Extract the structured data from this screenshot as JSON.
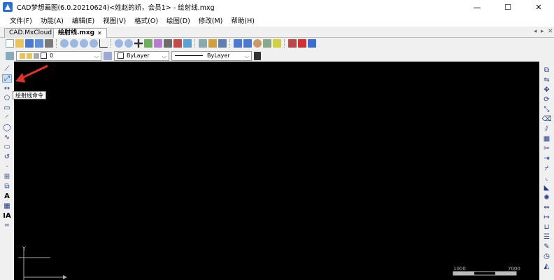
{
  "window": {
    "title": "CAD梦想画图(6.0.20210624)<姓赵的娇，会员1> - 绘射线.mxg",
    "minimize": "—",
    "maximize": "☐",
    "close": "✕"
  },
  "menu": [
    "文件(F)",
    "功能(A)",
    "编辑(E)",
    "视图(V)",
    "格式(O)",
    "绘图(D)",
    "修改(M)",
    "帮助(H)"
  ],
  "tabs": [
    {
      "label": "CAD.MxCloud",
      "active": false
    },
    {
      "label": "绘射线.mxg",
      "active": true
    }
  ],
  "tab_controls": {
    "left": "◂",
    "right": "▸",
    "close": "✕"
  },
  "layer_bar": {
    "layer_value": "0",
    "color_value": "ByLayer",
    "linetype_value": "ByLayer"
  },
  "tooltip": "绘射线命令",
  "canvas": {
    "ucs_y": "Y",
    "scale_labels": [
      "1000",
      "7000"
    ]
  },
  "colors": {
    "canvas_bg": "#000000",
    "annotation_arrow": "#e0302a",
    "icon_blue": "#1f3f8a"
  },
  "icons": {
    "left_toolbar": [
      "line-icon",
      "ray-icon",
      "xline-icon",
      "polygon-icon",
      "rectangle-icon",
      "arc-icon",
      "circle-icon",
      "spline-icon",
      "ellipse-icon",
      "ellipse-arc-icon",
      "point-icon",
      "insert-block-icon",
      "make-block-icon",
      "text-icon",
      "hatch-icon",
      "mtext-icon",
      "table-icon"
    ],
    "right_toolbar": [
      "copy-icon",
      "mirror-icon",
      "move-icon",
      "rotate-icon",
      "scale-icon",
      "erase-icon",
      "offset-icon",
      "array-icon",
      "trim-icon",
      "extend-icon",
      "break-icon",
      "fillet-icon",
      "chamfer-icon",
      "explode-icon",
      "stretch-icon",
      "lengthen-icon",
      "join-icon",
      "properties-icon",
      "match-icon",
      "measure-icon",
      "dimension-icon"
    ]
  }
}
